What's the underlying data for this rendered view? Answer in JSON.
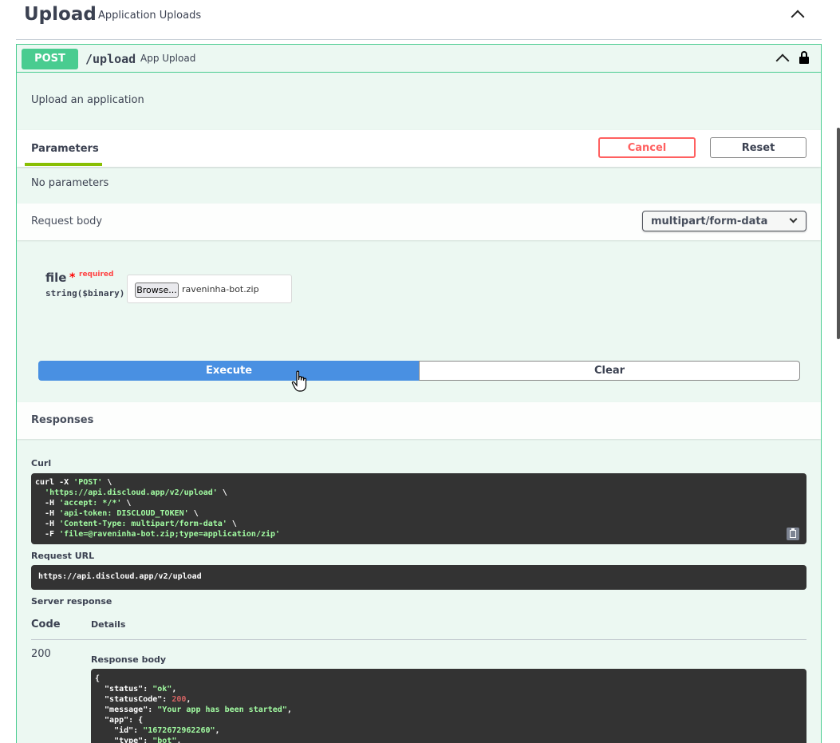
{
  "section": {
    "title": "Upload",
    "description": "Application Uploads"
  },
  "operation": {
    "method": "POST",
    "path": "/upload",
    "summary": "App Upload",
    "description": "Upload an application"
  },
  "parameters": {
    "tab_label": "Parameters",
    "cancel_label": "Cancel",
    "reset_label": "Reset",
    "empty_text": "No parameters"
  },
  "request_body": {
    "label": "Request body",
    "content_type": "multipart/form-data",
    "field": {
      "name": "file",
      "required_marker": "*",
      "required_text": "required",
      "type": "string($binary)",
      "browse_label": "Browse...",
      "file_name": "raveninha-bot.zip"
    }
  },
  "actions": {
    "execute_label": "Execute",
    "clear_label": "Clear"
  },
  "responses": {
    "label": "Responses",
    "curl_label": "Curl",
    "curl_lines": [
      {
        "plain": "curl -X ",
        "str": "'POST'",
        "tail": " \\"
      },
      {
        "plain": "  ",
        "str": "'https://api.discloud.app/v2/upload'",
        "tail": " \\"
      },
      {
        "plain": "  -H ",
        "str": "'accept: */*'",
        "tail": " \\"
      },
      {
        "plain": "  -H ",
        "str": "'api-token: DISCLOUD_TOKEN'",
        "tail": " \\"
      },
      {
        "plain": "  -H ",
        "str": "'Content-Type: multipart/form-data'",
        "tail": " \\"
      },
      {
        "plain": "  -F ",
        "str": "'file=@raveninha-bot.zip;type=application/zip'",
        "tail": ""
      }
    ],
    "request_url_label": "Request URL",
    "request_url": "https://api.discloud.app/v2/upload",
    "server_response_label": "Server response",
    "code_header": "Code",
    "details_header": "Details",
    "status_code": "200",
    "response_body_label": "Response body",
    "response_lines": [
      {
        "a": "{",
        "b": "",
        "c": ""
      },
      {
        "a": "  \"status\": ",
        "b": "\"ok\"",
        "c": ",",
        "t": "str"
      },
      {
        "a": "  \"statusCode\": ",
        "b": "200",
        "c": ",",
        "t": "num"
      },
      {
        "a": "  \"message\": ",
        "b": "\"Your app has been started\"",
        "c": ",",
        "t": "str"
      },
      {
        "a": "  \"app\": {",
        "b": "",
        "c": ""
      },
      {
        "a": "    \"id\": ",
        "b": "\"1672672962260\"",
        "c": ",",
        "t": "str"
      },
      {
        "a": "    \"type\": ",
        "b": "\"bot\"",
        "c": ",",
        "t": "str"
      }
    ]
  },
  "colors": {
    "post_green": "#49cc90",
    "execute_blue": "#4990e2",
    "cancel_red": "#ff6060",
    "code_bg": "#333333"
  }
}
